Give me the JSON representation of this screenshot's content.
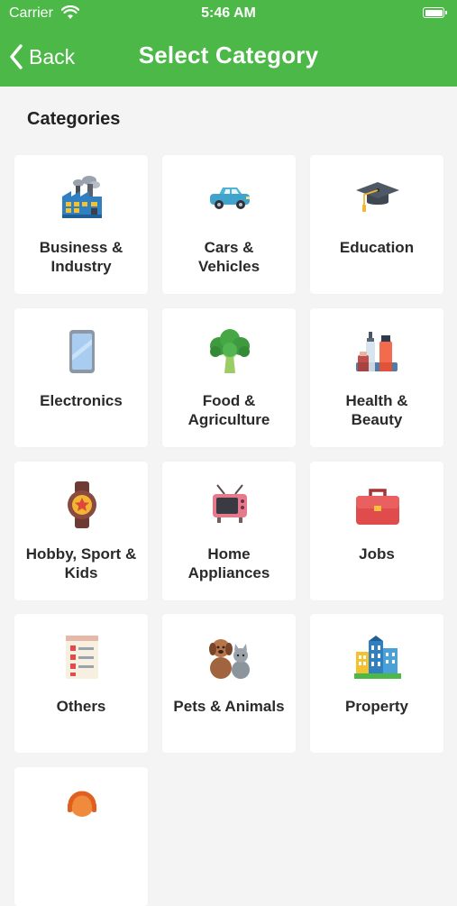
{
  "status_bar": {
    "carrier": "Carrier",
    "time": "5:46 AM"
  },
  "nav": {
    "back_label": "Back",
    "title": "Select Category"
  },
  "section_title": "Categories",
  "colors": {
    "brand_green": "#4cb848",
    "tile_bg": "#ffffff",
    "page_bg": "#f4f4f5"
  },
  "categories": [
    {
      "label": "Business &\nIndustry",
      "icon": "factory-icon"
    },
    {
      "label": "Cars &\nVehicles",
      "icon": "car-icon"
    },
    {
      "label": "Education",
      "icon": "graduation-cap-icon"
    },
    {
      "label": "Electronics",
      "icon": "smartphone-icon"
    },
    {
      "label": "Food &\nAgriculture",
      "icon": "broccoli-icon"
    },
    {
      "label": "Health &\nBeauty",
      "icon": "cosmetics-icon"
    },
    {
      "label": "Hobby, Sport &\nKids",
      "icon": "medal-icon"
    },
    {
      "label": "Home\nAppliances",
      "icon": "tv-icon"
    },
    {
      "label": "Jobs",
      "icon": "briefcase-icon"
    },
    {
      "label": "Others",
      "icon": "list-icon"
    },
    {
      "label": "Pets & Animals",
      "icon": "dog-cat-icon"
    },
    {
      "label": "Property",
      "icon": "buildings-icon"
    },
    {
      "label": "",
      "icon": "support-agent-icon"
    }
  ]
}
